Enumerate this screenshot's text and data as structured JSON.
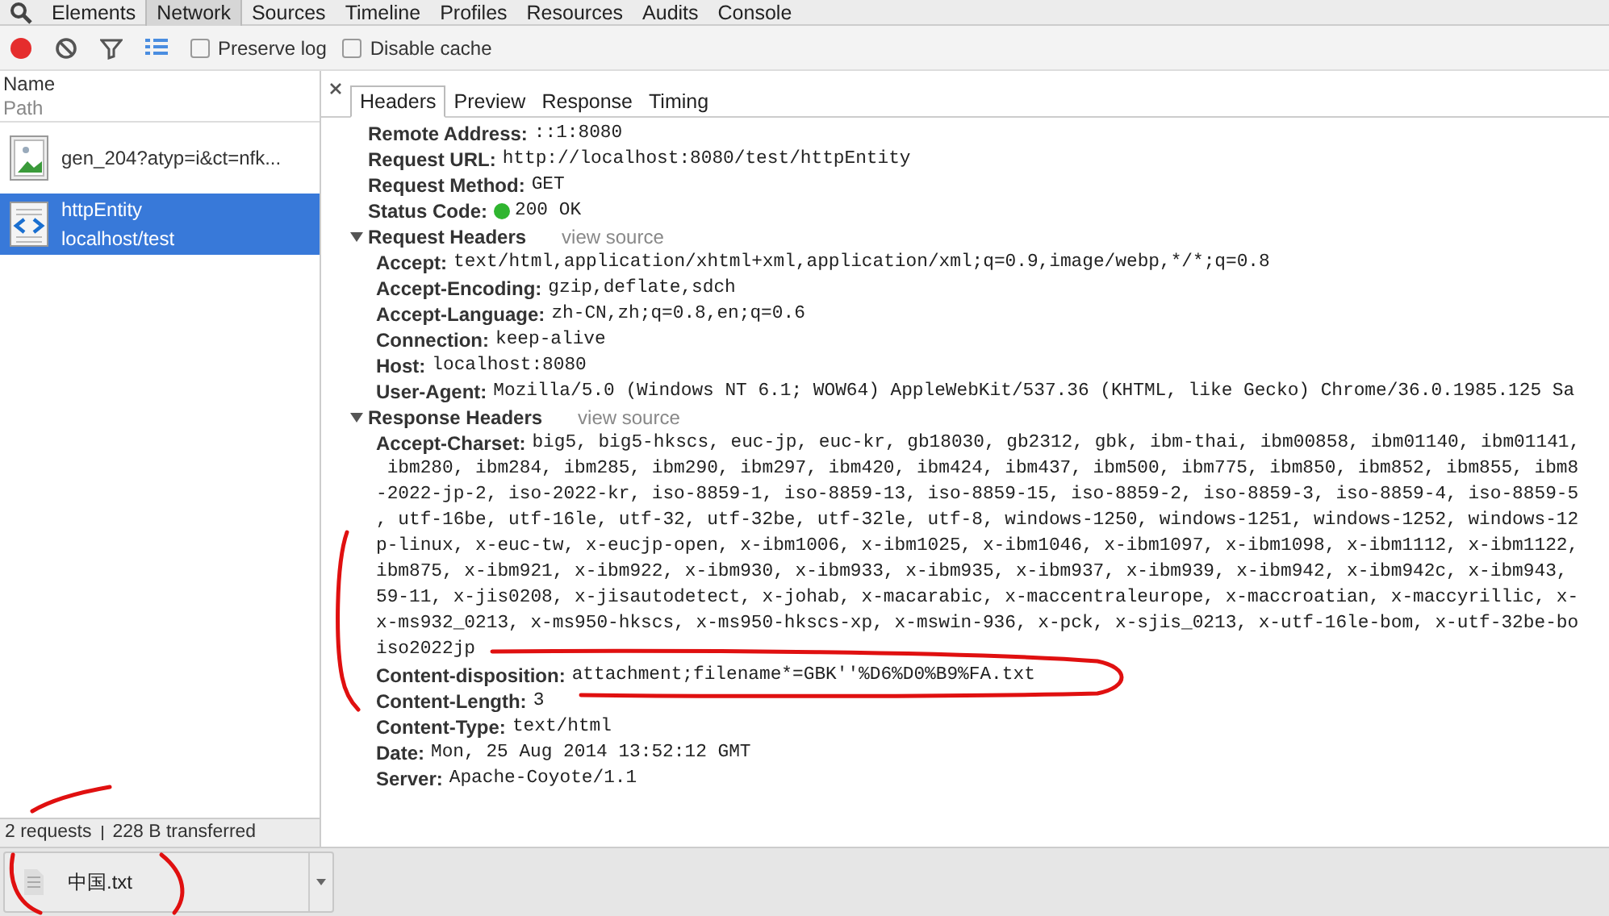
{
  "top_tabs": [
    {
      "label": "Elements",
      "selected": false
    },
    {
      "label": "Network",
      "selected": true
    },
    {
      "label": "Sources",
      "selected": false
    },
    {
      "label": "Timeline",
      "selected": false
    },
    {
      "label": "Profiles",
      "selected": false
    },
    {
      "label": "Resources",
      "selected": false
    },
    {
      "label": "Audits",
      "selected": false
    },
    {
      "label": "Console",
      "selected": false
    }
  ],
  "toolbar": {
    "recording": true,
    "checkboxes": [
      {
        "label": "Preserve log",
        "checked": false
      },
      {
        "label": "Disable cache",
        "checked": false
      }
    ]
  },
  "request_list": {
    "columns": [
      "Name",
      "Path"
    ],
    "rows": [
      {
        "kind": "image",
        "name": "gen_204?atyp=i&ct=nfk...",
        "selected": false
      },
      {
        "kind": "document",
        "name": "httpEntity",
        "path": "localhost/test",
        "selected": true
      }
    ]
  },
  "detail_tabs": [
    {
      "label": "Headers",
      "selected": true
    },
    {
      "label": "Preview",
      "selected": false
    },
    {
      "label": "Response",
      "selected": false
    },
    {
      "label": "Timing",
      "selected": false
    }
  ],
  "general": [
    {
      "kind": "text",
      "label": "Remote Address:",
      "value": "::1:8080"
    },
    {
      "kind": "text",
      "label": "Request URL:",
      "value": "http://localhost:8080/test/httpEntity"
    },
    {
      "kind": "text",
      "label": "Request Method:",
      "value": "GET"
    },
    {
      "kind": "status",
      "label": "Status Code:",
      "value": "200 OK"
    }
  ],
  "sections": [
    {
      "title": "Request Headers",
      "expanded": true,
      "link": "view source",
      "headers": [
        {
          "name": "Accept:",
          "lines": [
            "text/html,application/xhtml+xml,application/xml;q=0.9,image/webp,*/*;q=0.8"
          ]
        },
        {
          "name": "Accept-Encoding:",
          "lines": [
            "gzip,deflate,sdch"
          ]
        },
        {
          "name": "Accept-Language:",
          "lines": [
            "zh-CN,zh;q=0.8,en;q=0.6"
          ]
        },
        {
          "name": "Connection:",
          "lines": [
            "keep-alive"
          ]
        },
        {
          "name": "Host:",
          "lines": [
            "localhost:8080"
          ]
        },
        {
          "name": "User-Agent:",
          "lines": [
            "Mozilla/5.0 (Windows NT 6.1; WOW64) AppleWebKit/537.36 (KHTML, like Gecko) Chrome/36.0.1985.125 Sa"
          ]
        }
      ]
    },
    {
      "title": "Response Headers",
      "expanded": true,
      "link": "view source",
      "headers": [
        {
          "name": "Accept-Charset:",
          "lines": [
            "big5, big5-hkscs, euc-jp, euc-kr, gb18030, gb2312, gbk, ibm-thai, ibm00858, ibm01140, ibm01141,",
            " ibm280, ibm284, ibm285, ibm290, ibm297, ibm420, ibm424, ibm437, ibm500, ibm775, ibm850, ibm852, ibm855, ibm8",
            "-2022-jp-2, iso-2022-kr, iso-8859-1, iso-8859-13, iso-8859-15, iso-8859-2, iso-8859-3, iso-8859-4, iso-8859-5",
            ", utf-16be, utf-16le, utf-32, utf-32be, utf-32le, utf-8, windows-1250, windows-1251, windows-1252, windows-12",
            "p-linux, x-euc-tw, x-eucjp-open, x-ibm1006, x-ibm1025, x-ibm1046, x-ibm1097, x-ibm1098, x-ibm1112, x-ibm1122,",
            "ibm875, x-ibm921, x-ibm922, x-ibm930, x-ibm933, x-ibm935, x-ibm937, x-ibm939, x-ibm942, x-ibm942c, x-ibm943,",
            "59-11, x-jis0208, x-jisautodetect, x-johab, x-macarabic, x-maccentraleurope, x-maccroatian, x-maccyrillic, x-",
            "x-ms932_0213, x-ms950-hkscs, x-ms950-hkscs-xp, x-mswin-936, x-pck, x-sjis_0213, x-utf-16le-bom, x-utf-32be-bo",
            "iso2022jp"
          ]
        },
        {
          "name": "Content-disposition:",
          "lines": [
            "attachment;filename*=GBK''%D6%D0%B9%FA.txt"
          ]
        },
        {
          "name": "Content-Length:",
          "lines": [
            "3"
          ]
        },
        {
          "name": "Content-Type:",
          "lines": [
            "text/html"
          ]
        },
        {
          "name": "Date:",
          "lines": [
            "Mon, 25 Aug 2014 13:52:12 GMT"
          ]
        },
        {
          "name": "Server:",
          "lines": [
            "Apache-Coyote/1.1"
          ]
        }
      ]
    }
  ],
  "status_bar": [
    "2 requests",
    "228 B transferred"
  ],
  "download_shelf": {
    "file": "中国.txt"
  }
}
